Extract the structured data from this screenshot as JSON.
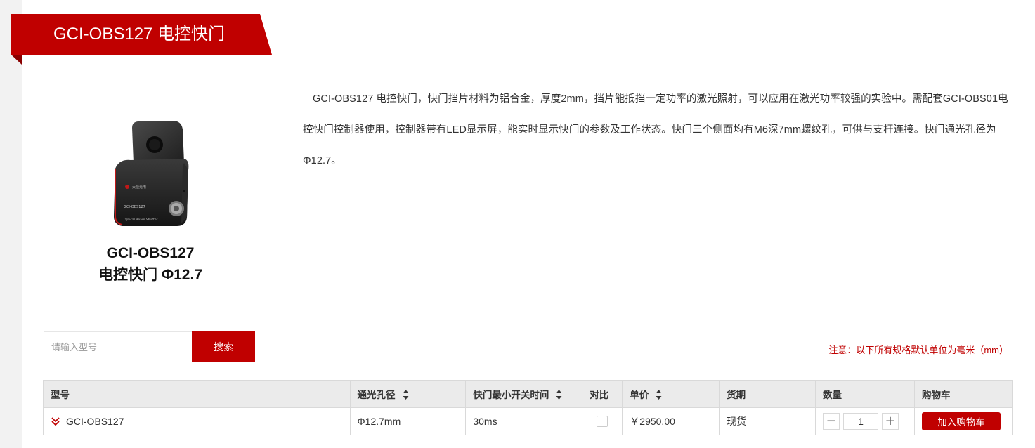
{
  "header": {
    "title": "GCI-OBS127 电控快门"
  },
  "product": {
    "name_line1": "GCI-OBS127",
    "name_line2": "电控快门  Φ12.7",
    "image_icon": "shutter-device-image",
    "device_label_brand": "大恒光电",
    "device_label_model": "GCI-OBS127",
    "device_label_desc": "Optical Beam Shutter"
  },
  "description": "GCI-OBS127 电控快门，快门挡片材料为铝合金，厚度2mm，挡片能抵挡一定功率的激光照射，可以应用在激光功率较强的实验中。需配套GCI-OBS01电控快门控制器使用，控制器带有LED显示屏，能实时显示快门的参数及工作状态。快门三个侧面均有M6深7mm螺纹孔，可供与支杆连接。快门通光孔径为Φ12.7。",
  "search": {
    "placeholder": "请输入型号",
    "button_label": "搜索"
  },
  "notice": "注意：以下所有规格默认单位为毫米（mm）",
  "table": {
    "headers": {
      "model": "型号",
      "aperture": "通光孔径",
      "min_time": "快门最小开关时间",
      "compare": "对比",
      "price": "单价",
      "delivery": "货期",
      "quantity": "数量",
      "cart": "购物车"
    },
    "rows": [
      {
        "model": "GCI-OBS127",
        "aperture": "Φ12.7mm",
        "min_time": "30ms",
        "price": "￥2950.00",
        "delivery": "现货",
        "quantity": "1",
        "minus": "−",
        "plus": "+",
        "cart_label": "加入购物车"
      }
    ]
  },
  "colors": {
    "accent": "#c00000",
    "header_bg": "#ebebeb",
    "page_bg": "#f2f2f2"
  }
}
